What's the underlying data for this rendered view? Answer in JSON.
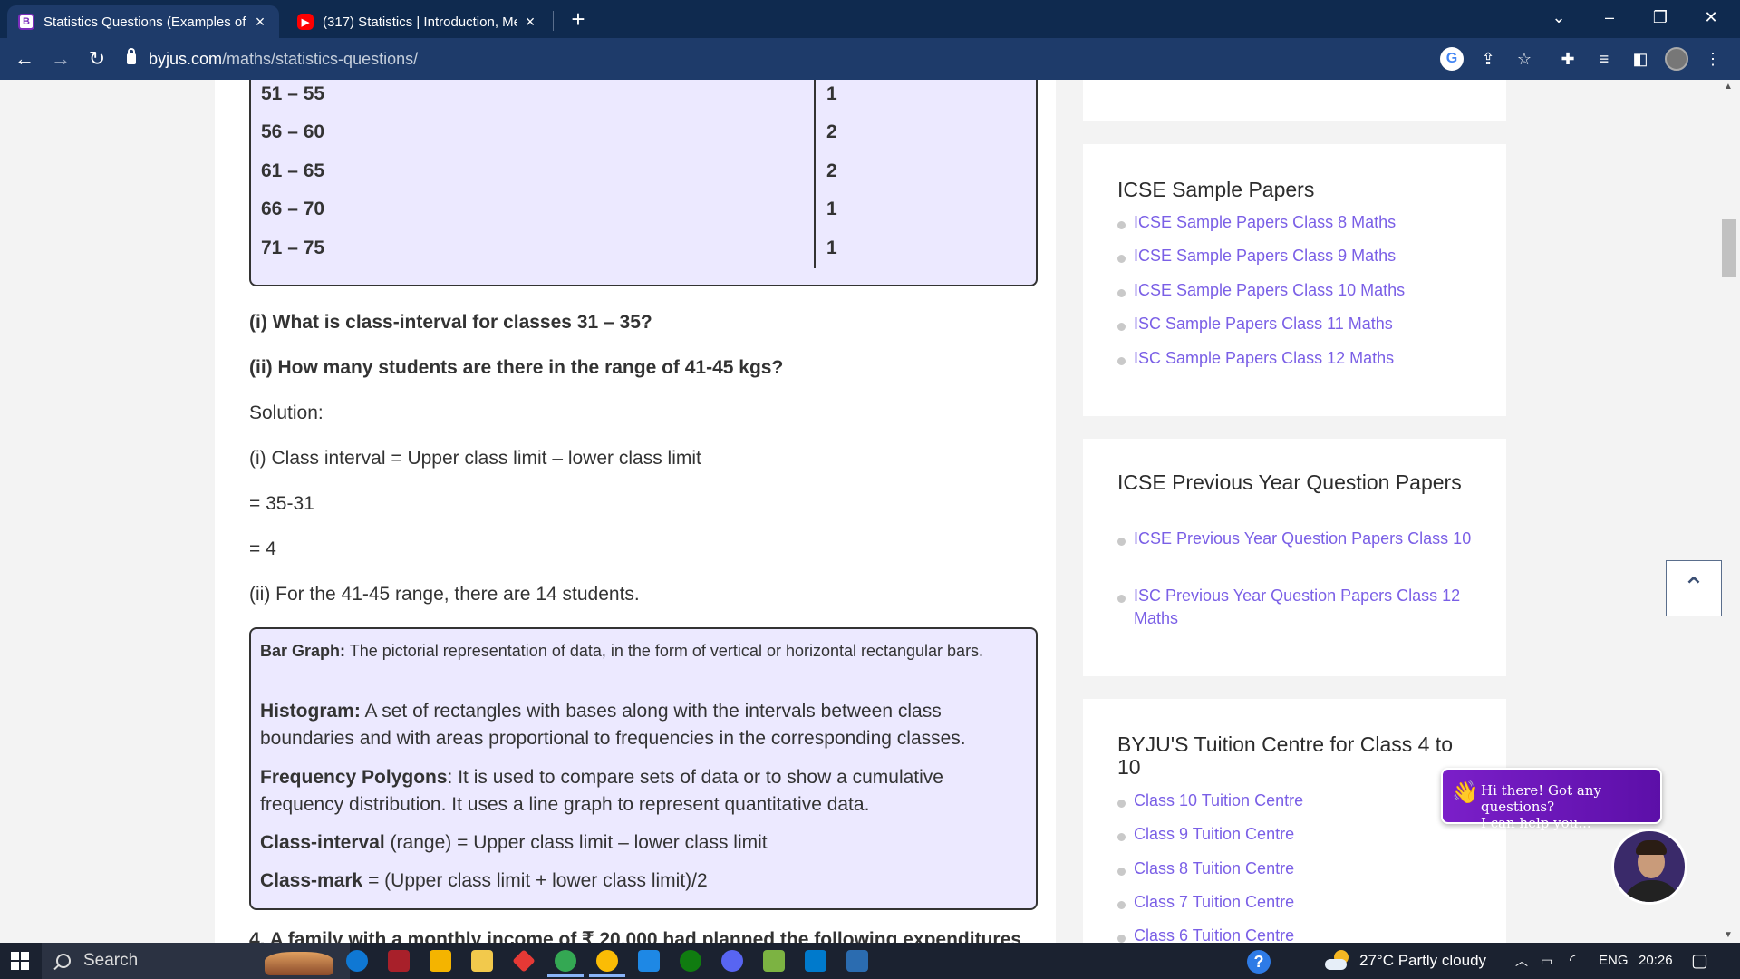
{
  "browser": {
    "tabs": [
      {
        "title": "Statistics Questions (Examples of",
        "icon": "byjus-favicon",
        "active": true
      },
      {
        "title": "(317) Statistics | Introduction, Me",
        "icon": "youtube-favicon",
        "active": false
      }
    ],
    "new_tab_label": "+",
    "url_host": "byjus.com",
    "url_path": "/maths/statistics-questions/"
  },
  "table": {
    "rows": [
      {
        "interval": "51 – 55",
        "count": "1"
      },
      {
        "interval": "56 – 60",
        "count": "2"
      },
      {
        "interval": "61 – 65",
        "count": "2"
      },
      {
        "interval": "66 – 70",
        "count": "1"
      },
      {
        "interval": "71 – 75",
        "count": "1"
      }
    ]
  },
  "questions": {
    "q1": "(i) What is class-interval for classes 31 – 35?",
    "q2": "(ii) How many students are there in the range of 41-45 kgs?"
  },
  "solution": {
    "heading": "Solution:",
    "line1": "(i) Class interval = Upper class limit – lower class limit",
    "line2": "= 35-31",
    "line3": "= 4",
    "line4": "(ii) For the 41-45 range, there are 14 students."
  },
  "definitions": {
    "bar_term": "Bar Graph:",
    "bar_text": " The pictorial representation of data, in the form of vertical or horizontal rectangular bars.",
    "hist_term": "Histogram:",
    "hist_text": " A set of rectangles with bases along with the intervals between class boundaries and with areas proportional to frequencies in the corresponding classes.",
    "freq_term": "Frequency Polygons",
    "freq_text": ": It is used to compare sets of data or to show a cumulative frequency distribution. It uses a line graph to represent quantitative data.",
    "ci_term": "Class-interval",
    "ci_text": " (range) = Upper class limit – lower class limit",
    "cm_term": "Class-mark",
    "cm_text": " = (Upper class limit + lower class limit)/2"
  },
  "cut_off_text": "4. A family with a monthly income of ₹ 20,000 had planned the following expenditures",
  "sidebar": {
    "icse_sample": {
      "title": "ICSE Sample Papers",
      "links": [
        "ICSE Sample Papers Class 8 Maths",
        "ICSE Sample Papers Class 9 Maths",
        "ICSE Sample Papers Class 10 Maths",
        "ISC Sample Papers Class 11 Maths",
        "ISC Sample Papers Class 12 Maths"
      ]
    },
    "icse_prev": {
      "title": "ICSE Previous Year Question Papers",
      "links": [
        "ICSE Previous Year Question Papers Class 10",
        "ISC Previous Year Question Papers Class 12 Maths"
      ]
    },
    "tuition": {
      "title": "BYJU'S Tuition Centre for Class 4 to 10",
      "links": [
        "Class 10 Tuition Centre",
        "Class 9 Tuition Centre",
        "Class 8 Tuition Centre",
        "Class 7 Tuition Centre",
        "Class 6 Tuition Centre"
      ]
    }
  },
  "chat": {
    "line1": "Hi there! Got any questions?",
    "line2": "I can help you..."
  },
  "taskbar": {
    "search_label": "Search",
    "weather": "27°C  Partly cloudy",
    "language": "ENG",
    "time": "20:26"
  },
  "colors": {
    "accent_link": "#7a5fe6",
    "definition_bg": "#ece9ff",
    "chrome_frame": "#1e3b6a"
  }
}
